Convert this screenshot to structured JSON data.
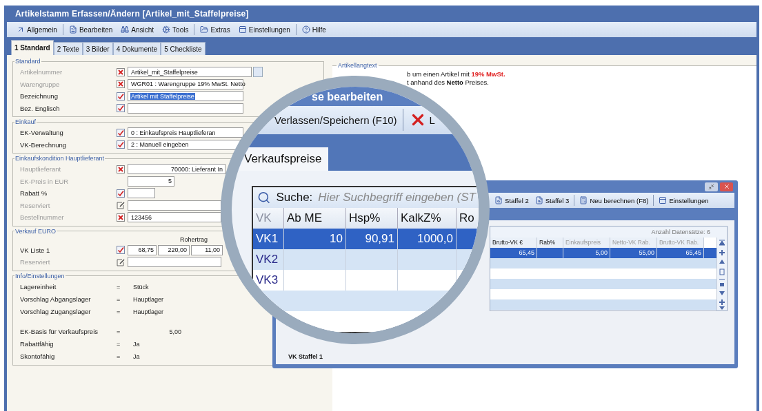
{
  "window": {
    "title": "Artikelstamm Erfassen/Ändern [Artikel_mit_Staffelpreise]"
  },
  "menu": [
    "Allgemein",
    "Bearbeiten",
    "Ansicht",
    "Tools",
    "Extras",
    "Einstellungen",
    "Hilfe"
  ],
  "tabs": [
    {
      "label": "1 Standard",
      "selected": true
    },
    {
      "label": "2 Texte",
      "selected": false
    },
    {
      "label": "3 Bilder",
      "selected": false
    },
    {
      "label": "4 Dokumente",
      "selected": false
    },
    {
      "label": "5 Checkliste",
      "selected": false
    }
  ],
  "form": {
    "sections": [
      {
        "title": "Standard",
        "rows": [
          {
            "kind": "field",
            "label": "Artikelnummer",
            "disabled": true,
            "required": true,
            "value": "Artikel_mit_Staffelpreise",
            "dropdown": true
          },
          {
            "kind": "field",
            "label": "Warengruppe",
            "disabled": true,
            "required": true,
            "value": "WGR01 : Warengruppe 19% MwSt. Netto"
          },
          {
            "kind": "field",
            "label": "Bezeichnung",
            "disabled": false,
            "required": false,
            "editable": true,
            "value": "Artikel mit Staffelpreise",
            "highlighted": true
          },
          {
            "kind": "field",
            "label": "Bez. Englisch",
            "disabled": false,
            "required": false,
            "editable": true
          }
        ]
      },
      {
        "title": "Einkauf",
        "rows": [
          {
            "kind": "field",
            "label": "EK-Verwaltung",
            "disabled": false,
            "required": false,
            "editable": true,
            "value": "0 : Einkaufspreis Hauptlieferan"
          },
          {
            "kind": "field",
            "label": "VK-Berechnung",
            "disabled": false,
            "required": false,
            "editable": true,
            "value": "2 : Manuell eingeben"
          }
        ]
      },
      {
        "title": "Einkaufskondition Hauptlieferant",
        "rows": [
          {
            "kind": "centered",
            "label": "Hauptlieferant",
            "disabled": true,
            "required": true,
            "value": "70000: Lieferant In"
          },
          {
            "kind": "amount",
            "label": "EK-Preis in EUR",
            "disabled": true,
            "value": "5"
          },
          {
            "kind": "short",
            "label": "Rabatt %",
            "disabled": false,
            "required": false,
            "editable": true
          },
          {
            "kind": "field",
            "label": "Reserviert",
            "disabled": true,
            "required": false,
            "editable": false,
            "locked": true
          },
          {
            "kind": "field",
            "label": "Bestellnummer",
            "disabled": true,
            "required": true,
            "value": "123456"
          }
        ]
      },
      {
        "title": "Verkauf EURO",
        "column_heading": "Rohertrag",
        "rows": [
          {
            "kind": "multi",
            "label": "VK Liste 1",
            "disabled": false,
            "required": false,
            "editable": true,
            "values": [
              "68,75",
              "220,00",
              "11,00"
            ]
          },
          {
            "kind": "field",
            "label": "Reserviert",
            "disabled": true,
            "required": false,
            "editable": false,
            "locked": true
          }
        ]
      },
      {
        "title": "Info/Einstellungen",
        "rows": [
          {
            "kind": "info",
            "label": "Lagereinheit",
            "sep": "=",
            "value": "Stück"
          },
          {
            "kind": "info",
            "label": "Vorschlag Abgangslager",
            "sep": "=",
            "value": "Hauptlager"
          },
          {
            "kind": "info",
            "label": "Vorschlag Zugangslager",
            "sep": "=",
            "value": "Hauptlager"
          },
          {
            "kind": "info",
            "label": "EK-Basis für Verkaufspreis",
            "sep": "=",
            "value": "5,00",
            "numeric": true,
            "gap_before": true
          },
          {
            "kind": "info",
            "label": "Rabattfähig",
            "sep": "=",
            "value": "Ja"
          },
          {
            "kind": "info",
            "label": "Skontofähig",
            "sep": "=",
            "value": "Ja"
          }
        ]
      }
    ]
  },
  "long_text": {
    "title": "Artikellangtext",
    "lines": [
      {
        "text": "b um einen Artikel mit ",
        "highlight": "19% MwSt."
      },
      {
        "text": "t anhand des **Netto** Preises."
      }
    ]
  },
  "staffel_dialog": {
    "toolbar": [
      "Staffel 2",
      "Staffel 3",
      "Neu berechnen (F8)",
      "Einstellungen"
    ],
    "record_count": "Anzahl Datensätze: 6",
    "columns": [
      {
        "label": "Brutto-VK €",
        "disabled": false
      },
      {
        "label": "Rab%",
        "disabled": false
      },
      {
        "label": "Einkaufspreis",
        "disabled": true
      },
      {
        "label": "Netto-VK Rab.",
        "disabled": true
      },
      {
        "label": "Brutto-VK Rab.",
        "disabled": true
      }
    ],
    "rows": [
      {
        "cells": [
          "65,45",
          null,
          "5,00",
          "55,00",
          "65,45"
        ],
        "selected": true
      }
    ],
    "footer": "VK Staffel 1"
  },
  "magnifier": {
    "title": "se bearbeiten",
    "toolbar": [
      {
        "kind": "save",
        "label": "Verlassen/Speichern (F10)"
      },
      {
        "kind": "delete",
        "label": "L"
      }
    ],
    "tabs": [
      {
        "label": "Verkaufspreise",
        "selected": true
      }
    ],
    "search": {
      "label": "Suche:",
      "placeholder": "Hier Suchbegriff eingeben (ST"
    },
    "columns": [
      "VK",
      "Ab ME",
      "Hsp%",
      "KalkZ%",
      "Ro"
    ],
    "rows": [
      {
        "cells": [
          "VK1",
          "10",
          "90,91",
          "1000,0"
        ],
        "selected": true
      },
      {
        "cells": [
          "VK2"
        ],
        "selected": false
      },
      {
        "cells": [
          "VK3"
        ],
        "selected": false
      }
    ]
  }
}
